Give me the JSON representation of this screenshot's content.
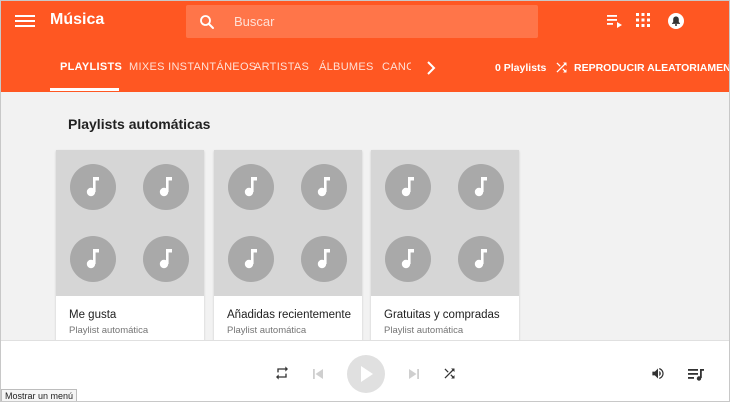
{
  "header": {
    "title": "Música",
    "search_placeholder": "Buscar"
  },
  "tabs": [
    {
      "label": "PLAYLISTS",
      "active": true
    },
    {
      "label": "MIXES INSTANTÁNEOS"
    },
    {
      "label": "ARTISTAS"
    },
    {
      "label": "ÁLBUMES"
    },
    {
      "label": "CANC"
    }
  ],
  "toolbar": {
    "playlists_count": "0 Playlists",
    "shuffle_label": "REPRODUCIR ALEATORIAMENTE"
  },
  "section": {
    "title": "Playlists automáticas"
  },
  "cards": [
    {
      "title": "Me gusta",
      "subtitle": "Playlist automática"
    },
    {
      "title": "Añadidas recientemente",
      "subtitle": "Playlist automática"
    },
    {
      "title": "Gratuitas y compradas",
      "subtitle": "Playlist automática"
    }
  ],
  "tooltip": "Mostrar un menú",
  "colors": {
    "accent": "#ff5722",
    "art_bg": "#d6d6d6",
    "note_bg": "#a9a9a9"
  },
  "icons": [
    "menu-icon",
    "search-icon",
    "queue-icon",
    "apps-icon",
    "notifications-icon",
    "chevron-right-icon",
    "shuffle-icon",
    "music-note-icon",
    "repeat-icon",
    "skip-previous-icon",
    "play-icon",
    "skip-next-icon",
    "volume-icon",
    "queue-music-icon"
  ]
}
